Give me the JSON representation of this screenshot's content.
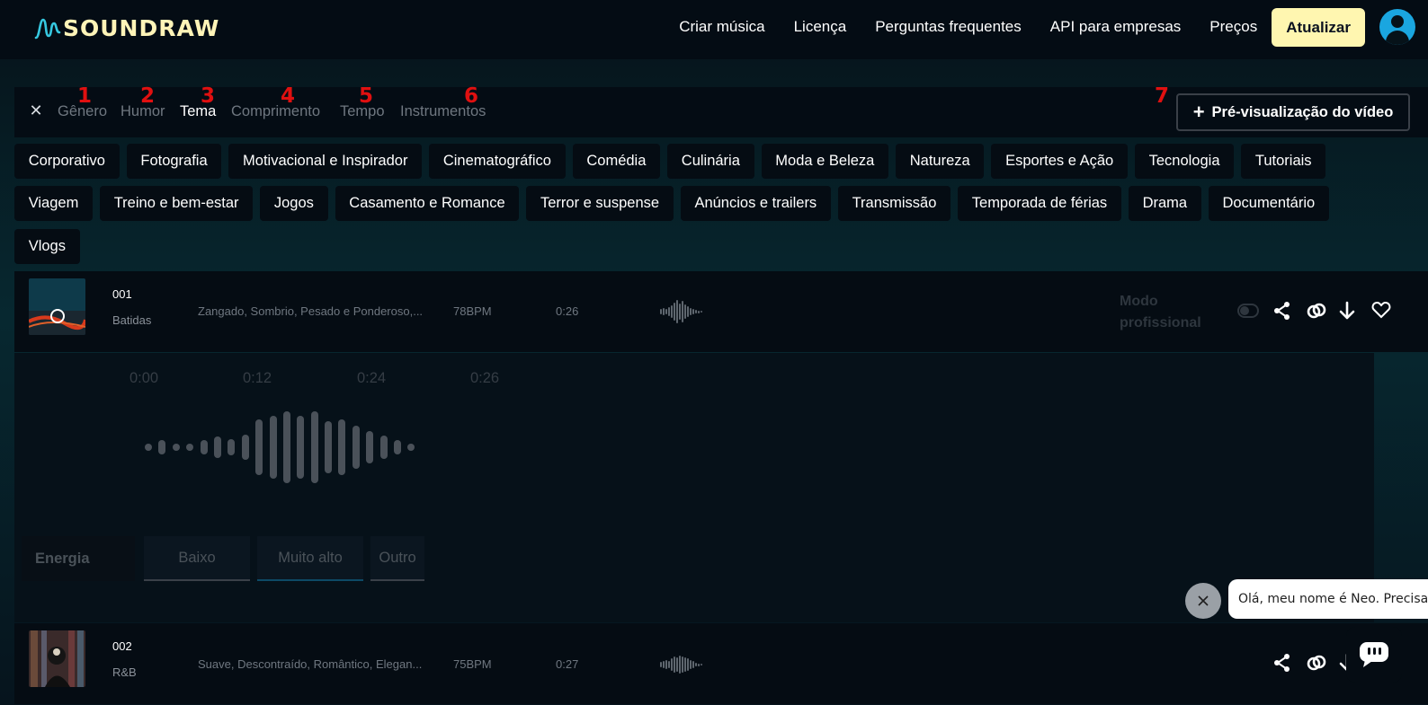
{
  "header": {
    "logo_text": "SOUNDRAW",
    "nav": [
      "Criar música",
      "Licença",
      "Perguntas frequentes",
      "API para empresas",
      "Preços"
    ],
    "upgrade_label": "Atualizar"
  },
  "filter_tabs": [
    {
      "label": "Gênero",
      "num": "1"
    },
    {
      "label": "Humor",
      "num": "2"
    },
    {
      "label": "Tema",
      "num": "3",
      "active": true
    },
    {
      "label": "Comprimento",
      "num": "4"
    },
    {
      "label": "Tempo",
      "num": "5"
    },
    {
      "label": "Instrumentos",
      "num": "6"
    }
  ],
  "preview": {
    "num": "7",
    "label": "Pré-visualização do vídeo"
  },
  "themes": {
    "row1": [
      "Corporativo",
      "Fotografia",
      "Motivacional e Inspirador",
      "Cinematográfico",
      "Comédia",
      "Culinária",
      "Moda e Beleza",
      "Natureza",
      "Esportes e Ação",
      "Tecnologia",
      "Tutoriais"
    ],
    "row2": [
      "Viagem",
      "Treino e bem-estar",
      "Jogos",
      "Casamento e Romance",
      "Terror e suspense",
      "Anúncios e trailers",
      "Transmissão",
      "Temporada de férias",
      "Drama",
      "Documentário"
    ],
    "row3": [
      "Vlogs"
    ]
  },
  "tracks": [
    {
      "num": "001",
      "genre": "Batidas",
      "tags": "Zangado, Sombrio, Pesado e Ponderoso,...",
      "bpm": "78BPM",
      "duration": "0:26",
      "pro_mode": "Modo profissional"
    },
    {
      "num": "002",
      "genre": "R&B",
      "tags": "Suave, Descontraído, Romântico, Elegan...",
      "bpm": "75BPM",
      "duration": "0:27"
    }
  ],
  "expanded": {
    "times": [
      "0:00",
      "0:12",
      "0:24",
      "0:26"
    ],
    "energy_label": "Energia",
    "energy_options": [
      "Baixo",
      "Muito alto",
      "Outro"
    ]
  },
  "chat": {
    "message": "Olá, meu nome é Neo. Precisa"
  },
  "colors": {
    "accent": "#fff6b0",
    "avatar": "#1aa6e0",
    "tab_number": "#e01010"
  }
}
